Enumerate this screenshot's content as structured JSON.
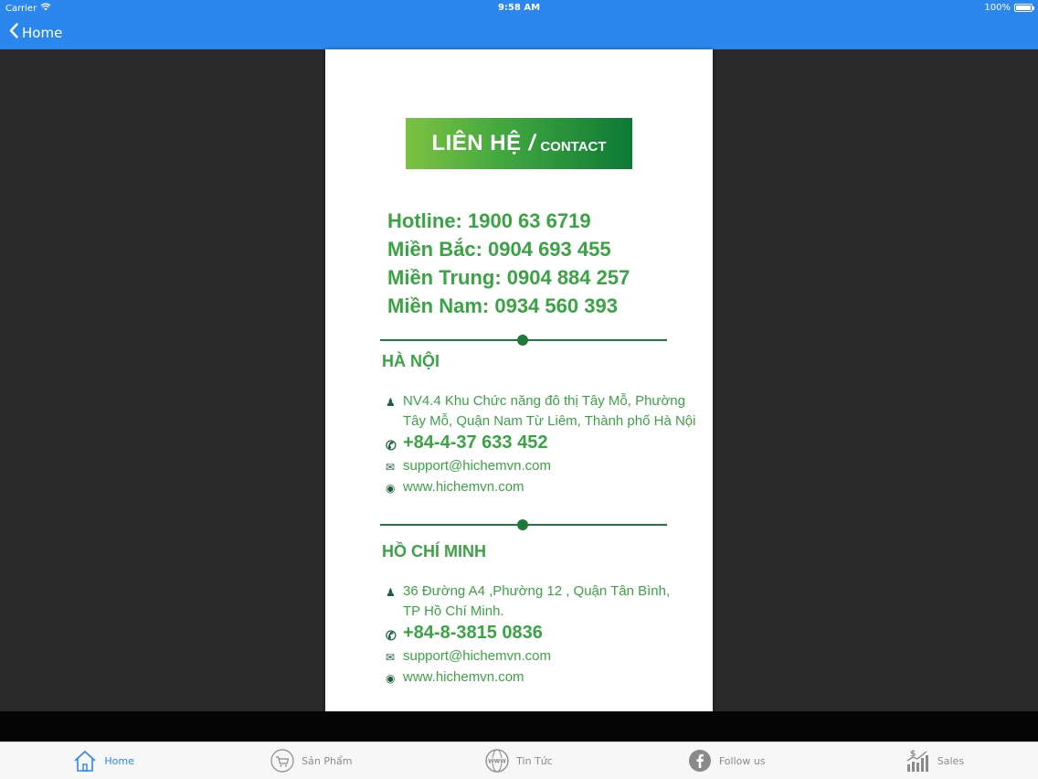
{
  "status_bar": {
    "carrier": "Carrier",
    "time": "9:58 AM",
    "battery": "100%"
  },
  "nav": {
    "back_label": "Home"
  },
  "card": {
    "banner": {
      "main": "LIÊN HỆ",
      "separator": "/",
      "sub": "CONTACT"
    },
    "phones": [
      "Hotline: 1900 63 6719",
      "Miền Bắc: 0904 693 455",
      "Miền Trung: 0904 884 257",
      "Miền Nam: 0934 560 393"
    ],
    "hanoi": {
      "title": "HÀ NỘI",
      "address_1": "NV4.4 Khu Chức năng đô thị Tây Mỗ, Phường",
      "address_2": "Tây Mỗ, Quận Nam Từ Liêm, Thành phố Hà Nội",
      "phone": "+84-4-37 633 452",
      "email": "support@hichemvn.com",
      "web": "www.hichemvn.com"
    },
    "hcm": {
      "title": "HỒ CHÍ MINH",
      "address_1": "36 Đường A4 ,Phường 12 , Quận Tân Bình,",
      "address_2": "TP Hồ Chí Minh.",
      "phone": "+84-8-3815 0836",
      "email": "support@hichemvn.com",
      "web": "www.hichemvn.com"
    }
  },
  "tabs": [
    {
      "label": "Home",
      "icon": "home-icon",
      "active": true
    },
    {
      "label": "Sản Phẩm",
      "icon": "cart-icon",
      "active": false
    },
    {
      "label": "Tin Tức",
      "icon": "globe-www-icon",
      "active": false
    },
    {
      "label": "Follow us",
      "icon": "facebook-icon",
      "active": false
    },
    {
      "label": "Sales",
      "icon": "sales-chart-icon",
      "active": false
    }
  ],
  "colors": {
    "accent": "#2b86ee",
    "brand_green": "#3aa344",
    "dark_green": "#1d7a3b"
  }
}
